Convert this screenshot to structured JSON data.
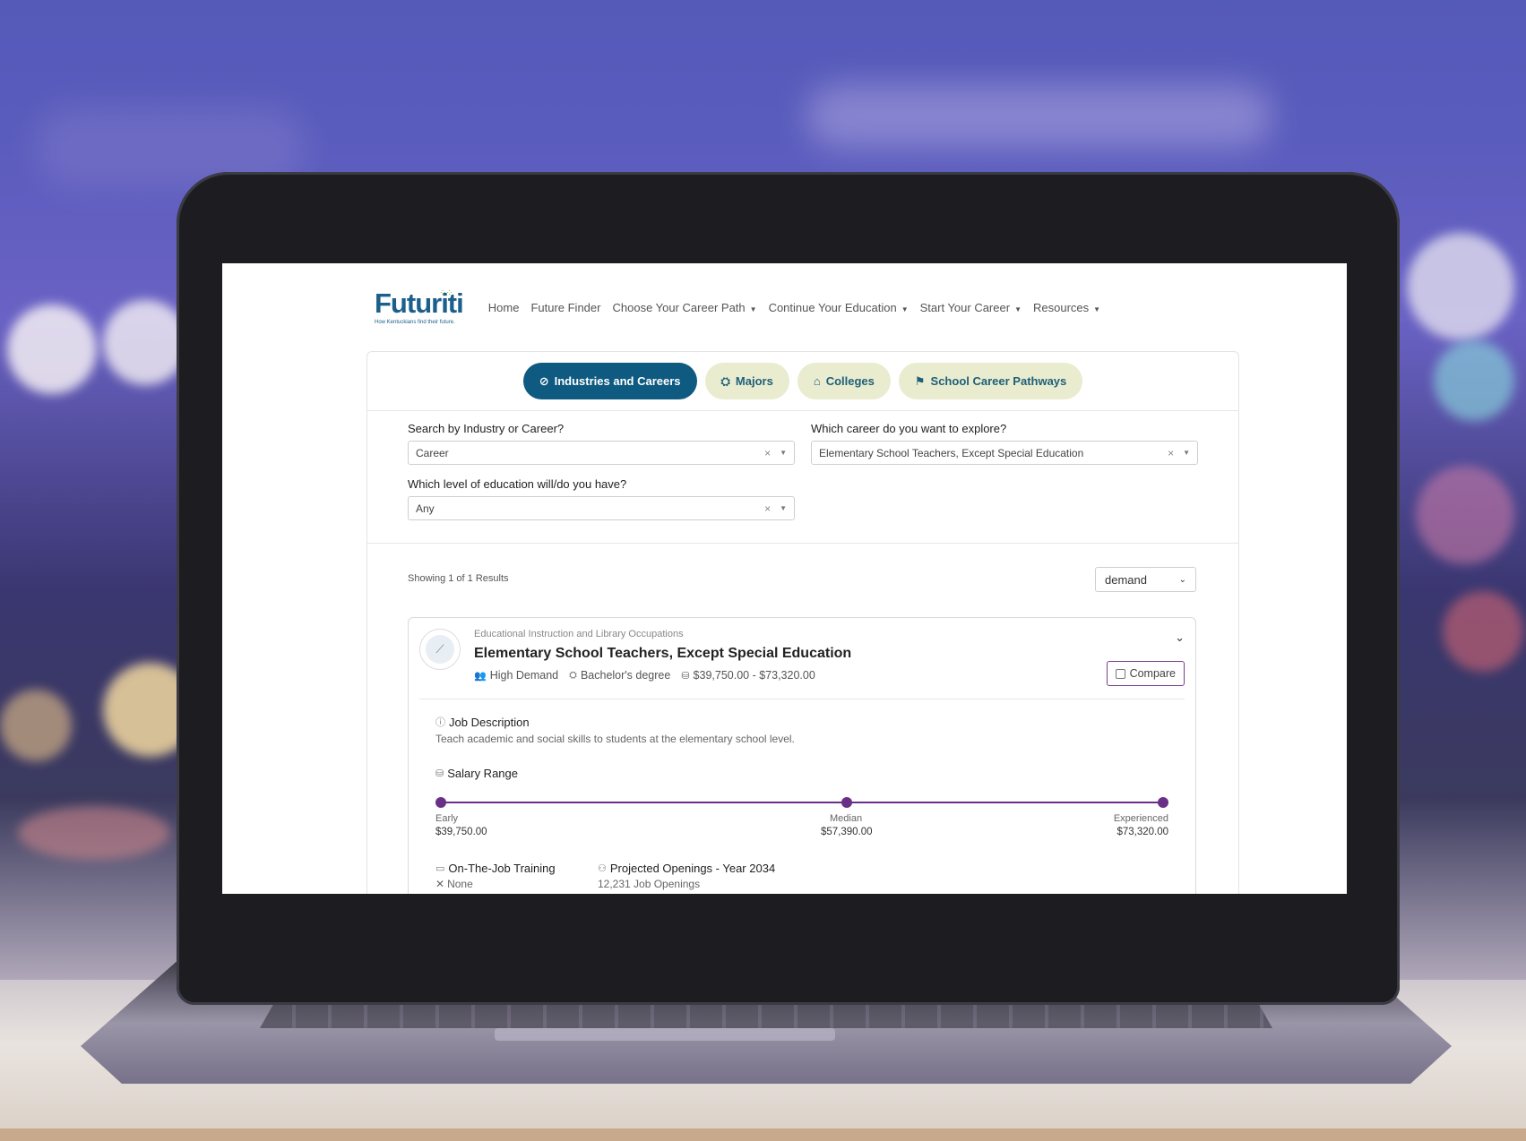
{
  "nav": {
    "logo": "Futuriti",
    "logo_tagline": "How Kentuckians find their future.",
    "items": [
      {
        "label": "Home",
        "dropdown": false
      },
      {
        "label": "Future Finder",
        "dropdown": false
      },
      {
        "label": "Choose Your Career Path",
        "dropdown": true
      },
      {
        "label": "Continue Your Education",
        "dropdown": true
      },
      {
        "label": "Start Your Career",
        "dropdown": true
      },
      {
        "label": "Resources",
        "dropdown": true
      }
    ]
  },
  "tabs": [
    {
      "label": "Industries and Careers",
      "icon": "compass-icon",
      "active": true
    },
    {
      "label": "Majors",
      "icon": "graduation-cap-icon",
      "active": false
    },
    {
      "label": "Colleges",
      "icon": "building-columns-icon",
      "active": false
    },
    {
      "label": "School Career Pathways",
      "icon": "signpost-icon",
      "active": false
    }
  ],
  "filters": {
    "search_by": {
      "label": "Search by Industry or Career?",
      "value": "Career"
    },
    "career": {
      "label": "Which career do you want to explore?",
      "value": "Elementary School Teachers, Except Special Education"
    },
    "education": {
      "label": "Which level of education will/do you have?",
      "value": "Any"
    }
  },
  "results": {
    "showing": "Showing 1 of 1 Results",
    "sort_value": "demand"
  },
  "card": {
    "category": "Educational Instruction and Library Occupations",
    "title": "Elementary School Teachers, Except Special Education",
    "demand": "High Demand",
    "degree": "Bachelor's degree",
    "salary": "$39,750.00 - $73,320.00",
    "compare_label": "Compare",
    "job_description_title": "Job Description",
    "job_description": "Teach academic and social skills to students at the elementary school level.",
    "salary_range_title": "Salary Range",
    "salary_range": {
      "early_label": "Early",
      "early_value": "$39,750.00",
      "median_label": "Median",
      "median_value": "$57,390.00",
      "experienced_label": "Experienced",
      "experienced_value": "$73,320.00"
    },
    "training_title": "On-The-Job Training",
    "training_value": "None",
    "openings_title": "Projected Openings - Year 2034",
    "openings_value": "12,231 Job Openings"
  },
  "colors": {
    "brand_blue": "#0e5a80",
    "tab_inactive": "#e9eccf",
    "accent_purple": "#6a2f86"
  }
}
